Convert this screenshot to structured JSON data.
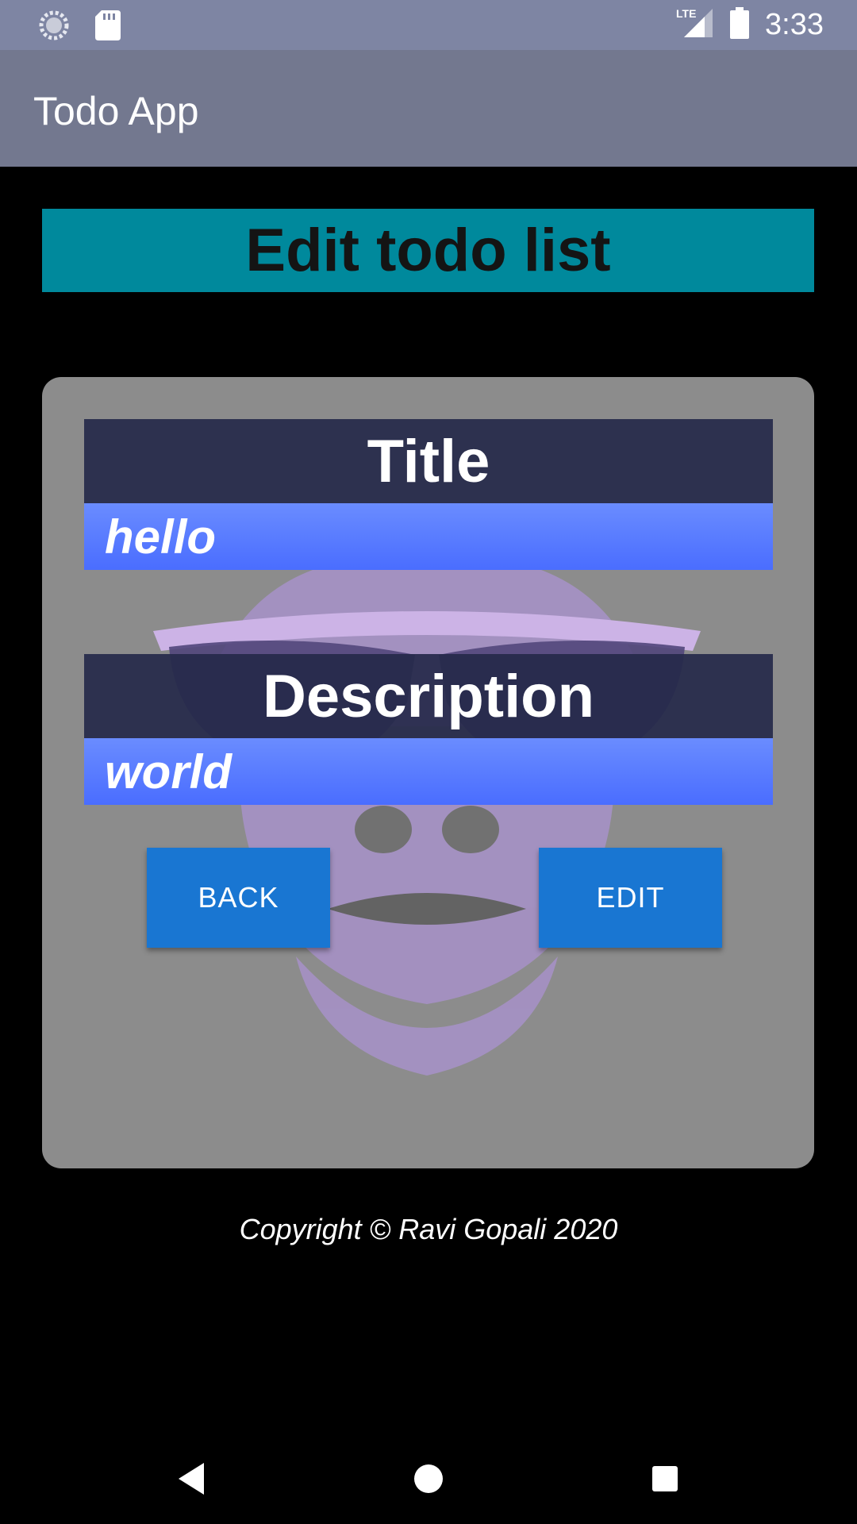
{
  "status_bar": {
    "time": "3:33",
    "network": "LTE",
    "icons": [
      "sync-icon",
      "sd-card-icon",
      "signal-icon",
      "battery-icon"
    ]
  },
  "app_bar": {
    "title": "Todo App"
  },
  "page": {
    "heading": "Edit todo list"
  },
  "form": {
    "title_label": "Title",
    "title_value": "hello",
    "description_label": "Description",
    "description_value": "world"
  },
  "buttons": {
    "back_label": "BACK",
    "edit_label": "EDIT"
  },
  "footer": {
    "copyright": "Copyright © Ravi Gopali 2020"
  },
  "nav_bar": {
    "icons": [
      "back-icon",
      "home-icon",
      "recents-icon"
    ]
  },
  "colors": {
    "status_bar": "#7e85a3",
    "app_bar": "#73788f",
    "heading_banner": "#00899c",
    "card": "#8c8c8c",
    "label_bg": "#262a4a",
    "input_bg": "#5a7dff",
    "button": "#1976d2"
  }
}
